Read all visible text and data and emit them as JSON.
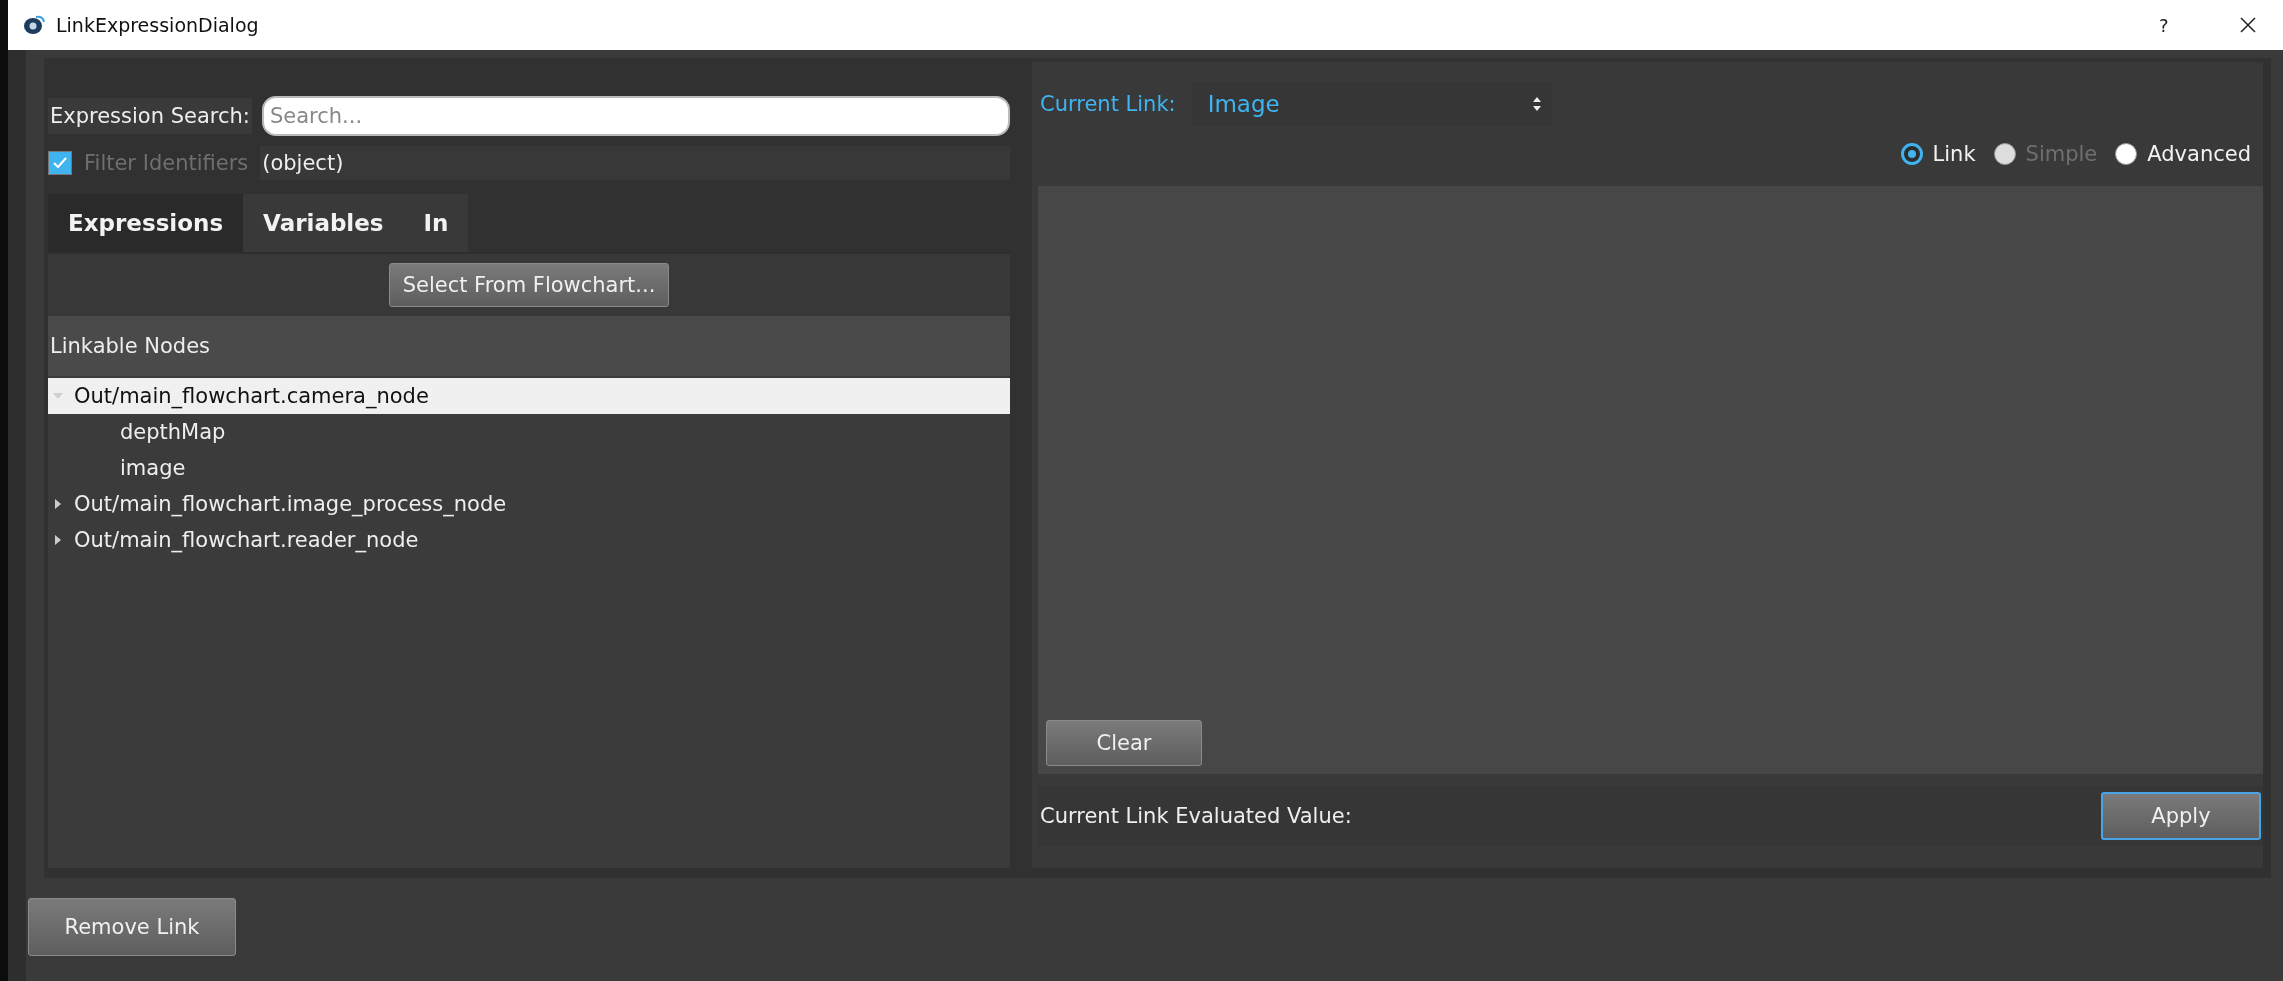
{
  "window": {
    "title": "LinkExpressionDialog",
    "help": "?"
  },
  "search": {
    "label": "Expression Search:",
    "placeholder": "Search..."
  },
  "filter": {
    "label": "Filter Identifiers",
    "checked": true,
    "disabled": true,
    "value": "(object)"
  },
  "tabs": [
    {
      "label": "Expressions",
      "selected": true
    },
    {
      "label": "Variables",
      "selected": false
    },
    {
      "label": "In",
      "selected": false
    }
  ],
  "select_button": "Select From Flowchart...",
  "tree": {
    "header": "Linkable Nodes",
    "items": [
      {
        "label": "Out/main_flowchart.camera_node",
        "expanded": true,
        "selected": true,
        "children": [
          {
            "label": "depthMap"
          },
          {
            "label": "image"
          }
        ]
      },
      {
        "label": "Out/main_flowchart.image_process_node",
        "expanded": false,
        "selected": false
      },
      {
        "label": "Out/main_flowchart.reader_node",
        "expanded": false,
        "selected": false
      }
    ]
  },
  "current_link": {
    "label": "Current Link:",
    "value": "Image"
  },
  "modes": [
    {
      "label": "Link",
      "selected": true,
      "disabled": false
    },
    {
      "label": "Simple",
      "selected": false,
      "disabled": true
    },
    {
      "label": "Advanced",
      "selected": false,
      "disabled": false
    }
  ],
  "clear_button": "Clear",
  "evaluated_label": "Current Link Evaluated Value:",
  "apply_button": "Apply",
  "remove_button": "Remove Link"
}
